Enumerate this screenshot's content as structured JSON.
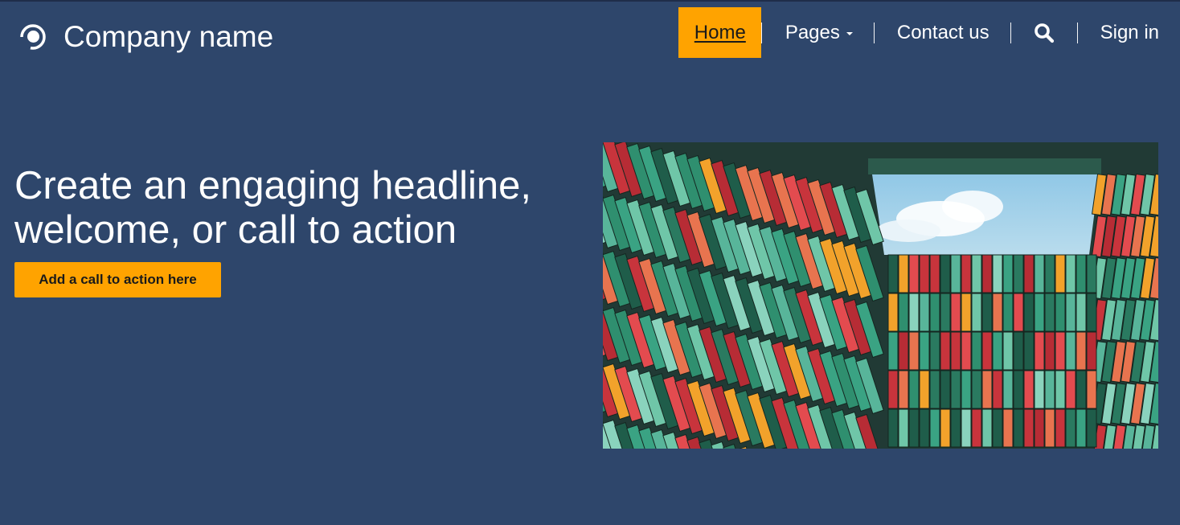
{
  "brand": {
    "name": "Company name",
    "logo_icon": "company-logo-icon"
  },
  "nav": {
    "home": "Home",
    "pages": "Pages",
    "contact": "Contact us",
    "search_icon": "search-icon",
    "signin": "Sign in"
  },
  "hero": {
    "headline": "Create an engaging headline, welcome, or call to action",
    "cta_label": "Add a call to action here",
    "image_alt": "Colorful building facade looking up at sky"
  },
  "colors": {
    "background": "#2e466b",
    "accent": "#ffa300",
    "text": "#ffffff"
  }
}
